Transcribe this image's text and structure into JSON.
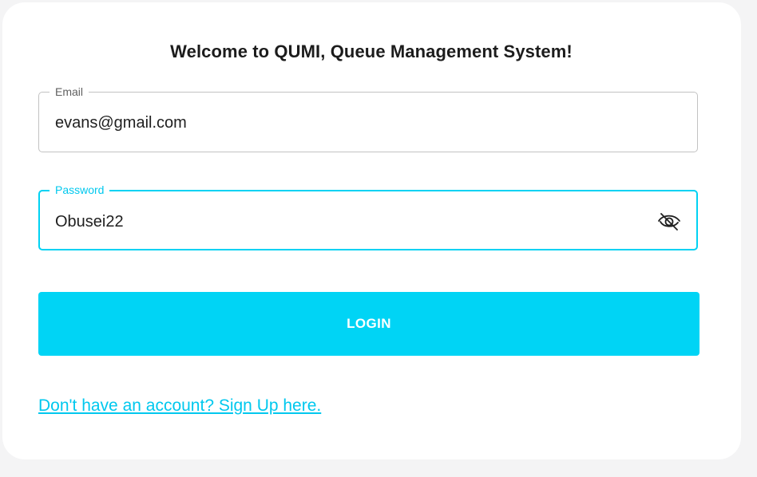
{
  "form": {
    "title": "Welcome to QUMI, Queue Management System!",
    "email": {
      "label": "Email",
      "value": "evans@gmail.com"
    },
    "password": {
      "label": "Password",
      "value": "Obusei22",
      "toggle_icon": "eye-off-icon"
    },
    "login_label": "LOGIN",
    "signup_link": "Don't have an account? Sign Up here."
  },
  "colors": {
    "accent": "#00d4f5",
    "card_background": "#ffffff",
    "page_background": "#f4f4f5"
  }
}
